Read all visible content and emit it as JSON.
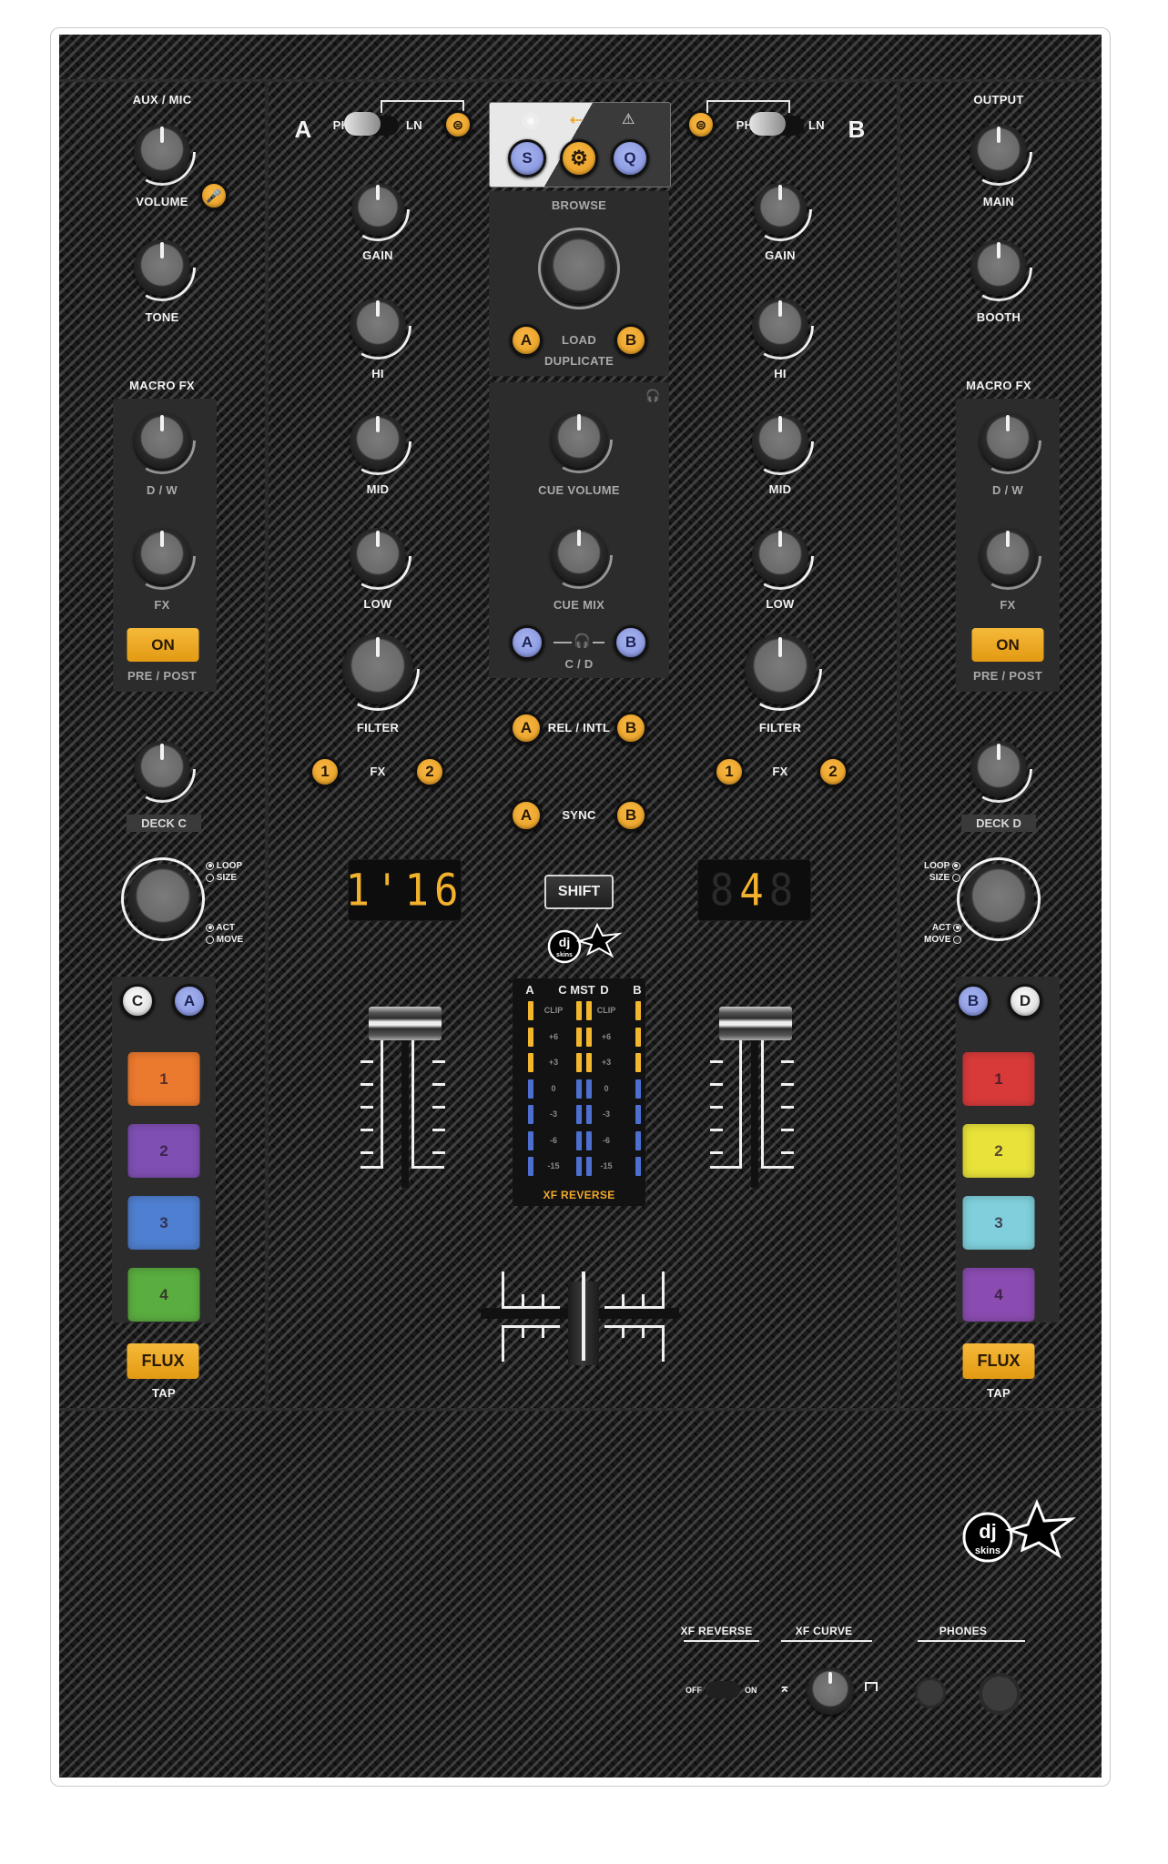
{
  "device": "DJ mixer controller skin",
  "skin_brand": "djskins",
  "colors": {
    "panel_bg": "#1a1a1a",
    "accent_orange": "#f0a92b",
    "accent_blue": "#8c99e0",
    "display_digit": "#f3b22d",
    "meter_orange": "#f2b72e",
    "meter_blue": "#4c6fd0"
  },
  "left_column": {
    "aux_mic_label": "AUX / MIC",
    "volume_label": "VOLUME",
    "mic_icon": "microphone-icon",
    "tone_label": "TONE",
    "macro_fx_label": "MACRO FX",
    "dw_label": "D / W",
    "fx_label": "FX",
    "on_button": "ON",
    "pre_post_label": "PRE / POST",
    "deck_label": "DECK C",
    "loop_label": "LOOP",
    "size_label": "SIZE",
    "act_label": "ACT",
    "move_label": "MOVE",
    "deck_buttons": [
      "C",
      "A"
    ],
    "pads": [
      {
        "label": "1",
        "color": "#ec7a2e"
      },
      {
        "label": "2",
        "color": "#7f4fb3"
      },
      {
        "label": "3",
        "color": "#4f7fd0"
      },
      {
        "label": "4",
        "color": "#5aad3f"
      }
    ],
    "flux_button": "FLUX",
    "tap_label": "TAP"
  },
  "right_column": {
    "output_label": "OUTPUT",
    "main_label": "MAIN",
    "booth_label": "BOOTH",
    "macro_fx_label": "MACRO FX",
    "dw_label": "D / W",
    "fx_label": "FX",
    "on_button": "ON",
    "pre_post_label": "PRE / POST",
    "deck_label": "DECK D",
    "loop_label": "LOOP",
    "size_label": "SIZE",
    "act_label": "ACT",
    "move_label": "MOVE",
    "deck_buttons": [
      "B",
      "D"
    ],
    "pads": [
      {
        "label": "1",
        "color": "#d83a3a"
      },
      {
        "label": "2",
        "color": "#e8e23a"
      },
      {
        "label": "3",
        "color": "#7fd0dc"
      },
      {
        "label": "4",
        "color": "#8a4cb0"
      }
    ],
    "flux_button": "FLUX",
    "tap_label": "TAP"
  },
  "channel_a": {
    "letter": "A",
    "ph_label": "PH",
    "ln_label": "LN",
    "input_icon": "traktor-input-icon",
    "gain_label": "GAIN",
    "hi_label": "HI",
    "mid_label": "MID",
    "low_label": "LOW",
    "filter_label": "FILTER",
    "fx_label": "FX",
    "fx_buttons": [
      "1",
      "2"
    ],
    "display": "1'16",
    "fader_level": 1.0
  },
  "channel_b": {
    "letter": "B",
    "ph_label": "PH",
    "ln_label": "LN",
    "input_icon": "traktor-input-icon",
    "gain_label": "GAIN",
    "hi_label": "HI",
    "mid_label": "MID",
    "low_label": "LOW",
    "filter_label": "FILTER",
    "fx_label": "FX",
    "fx_buttons": [
      "1",
      "2"
    ],
    "display": "4",
    "fader_level": 1.0
  },
  "center": {
    "status_icons": [
      "power-led-icon",
      "usb-icon",
      "warning-icon"
    ],
    "top_buttons": [
      "S",
      "gear",
      "Q"
    ],
    "browse_label": "BROWSE",
    "load_label": "LOAD",
    "duplicate_label": "DUPLICATE",
    "load_buttons": [
      "A",
      "B"
    ],
    "cue_volume_label": "CUE VOLUME",
    "cue_mix_label": "CUE MIX",
    "cue_buttons": [
      "A",
      "B"
    ],
    "cd_label": "C / D",
    "rel_intl_label": "REL / INTL",
    "rel_buttons": [
      "A",
      "B"
    ],
    "sync_label": "SYNC",
    "sync_buttons": [
      "A",
      "B"
    ],
    "shift_label": "SHIFT",
    "meter": {
      "headers": [
        "A",
        "C",
        "MST",
        "D",
        "B"
      ],
      "scale": [
        "CLIP",
        "+6",
        "+3",
        "0",
        "-3",
        "-6",
        "-15"
      ],
      "footer": "XF REVERSE"
    },
    "crossfader_position": 0.5
  },
  "bottom_panel": {
    "xf_reverse_label": "XF REVERSE",
    "off_label": "OFF",
    "on_label": "ON",
    "xf_curve_label": "XF CURVE",
    "phones_label": "PHONES"
  }
}
